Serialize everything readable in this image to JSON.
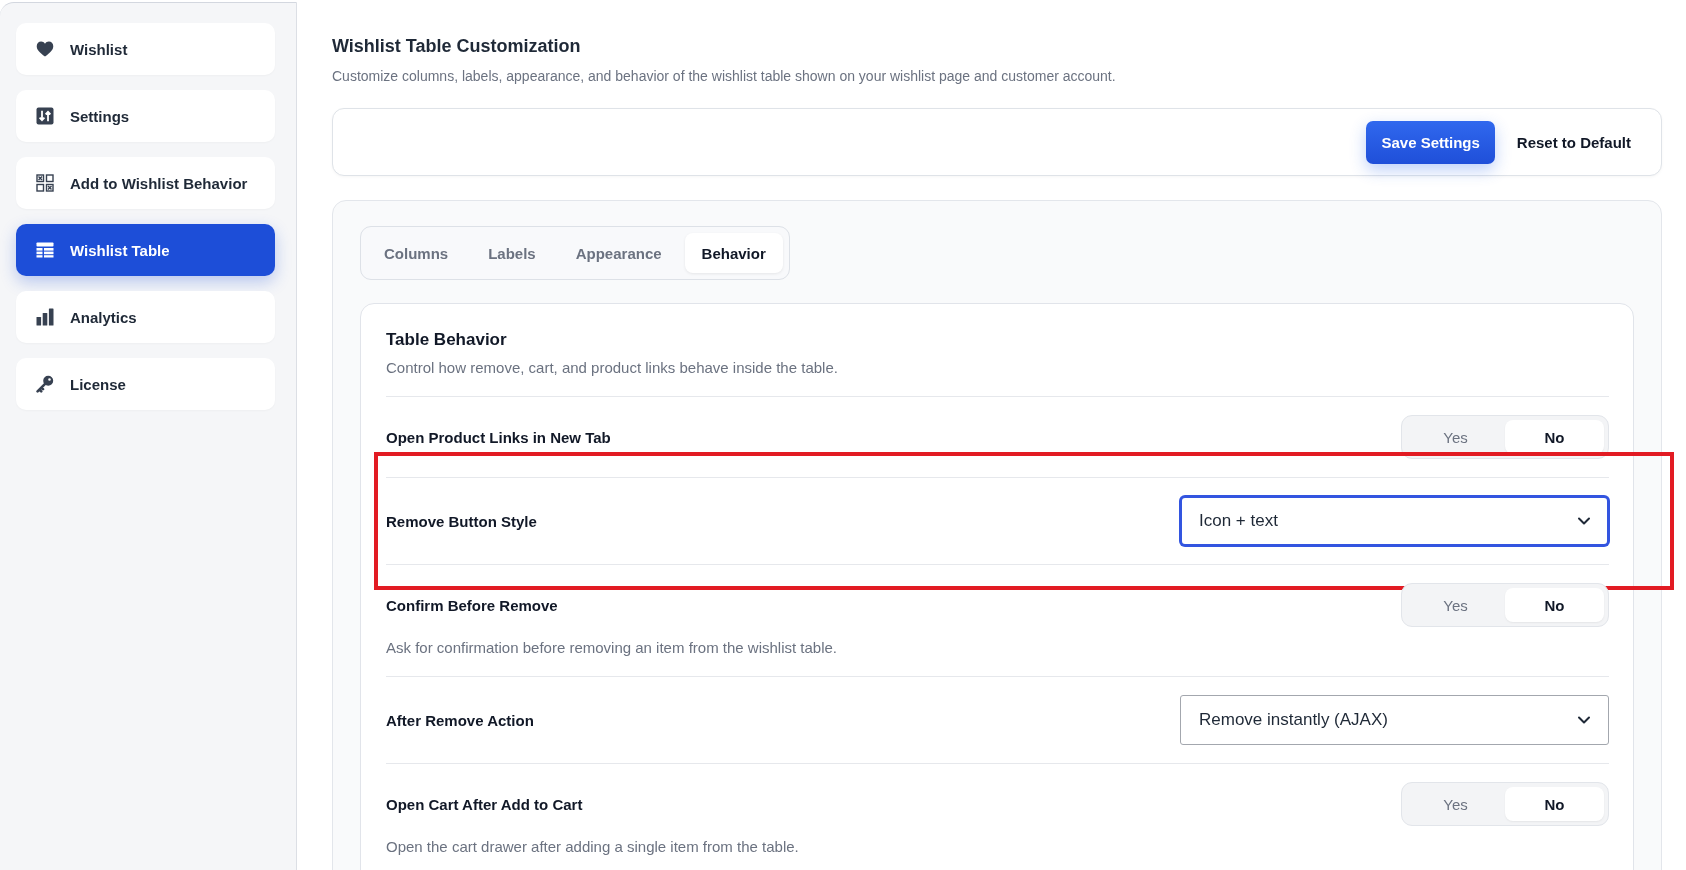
{
  "sidebar": {
    "items": [
      {
        "label": "Wishlist",
        "selected": false
      },
      {
        "label": "Settings",
        "selected": false
      },
      {
        "label": "Add to Wishlist Behavior",
        "selected": false
      },
      {
        "label": "Wishlist Table",
        "selected": true
      },
      {
        "label": "Analytics",
        "selected": false
      },
      {
        "label": "License",
        "selected": false
      }
    ]
  },
  "header": {
    "title": "Wishlist Table Customization",
    "subtitle": "Customize columns, labels, appearance, and behavior of the wishlist table shown on your wishlist page and customer account."
  },
  "toolbar": {
    "buttons": [
      {
        "label": "Save Settings",
        "kind": "primary"
      },
      {
        "label": "Reset to Default",
        "kind": "plain"
      }
    ]
  },
  "tabs": [
    {
      "label": "Columns",
      "selected": false
    },
    {
      "label": "Labels",
      "selected": false
    },
    {
      "label": "Appearance",
      "selected": false
    },
    {
      "label": "Behavior",
      "selected": true
    }
  ],
  "section": {
    "title": "Table Behavior",
    "description": "Control how remove, cart, and product links behave inside the table.",
    "rows": [
      {
        "kind": "toggle",
        "label": "Open Product Links in New Tab",
        "options": [
          {
            "label": "Yes",
            "selected": false
          },
          {
            "label": "No",
            "selected": true
          }
        ],
        "highlighted": false
      },
      {
        "kind": "select",
        "label": "Remove Button Style",
        "value": "Icon + text",
        "focused": true,
        "highlighted": true
      },
      {
        "kind": "toggle",
        "label": "Confirm Before Remove",
        "description": "Ask for confirmation before removing an item from the wishlist table.",
        "options": [
          {
            "label": "Yes",
            "selected": false
          },
          {
            "label": "No",
            "selected": true
          }
        ],
        "highlighted": false
      },
      {
        "kind": "select",
        "label": "After Remove Action",
        "value": "Remove instantly (AJAX)",
        "focused": false,
        "highlighted": false
      },
      {
        "kind": "toggle",
        "label": "Open Cart After Add to Cart",
        "description": "Open the cart drawer after adding a single item from the table.",
        "options": [
          {
            "label": "Yes",
            "selected": false
          },
          {
            "label": "No",
            "selected": true
          }
        ],
        "highlighted": false
      }
    ]
  }
}
